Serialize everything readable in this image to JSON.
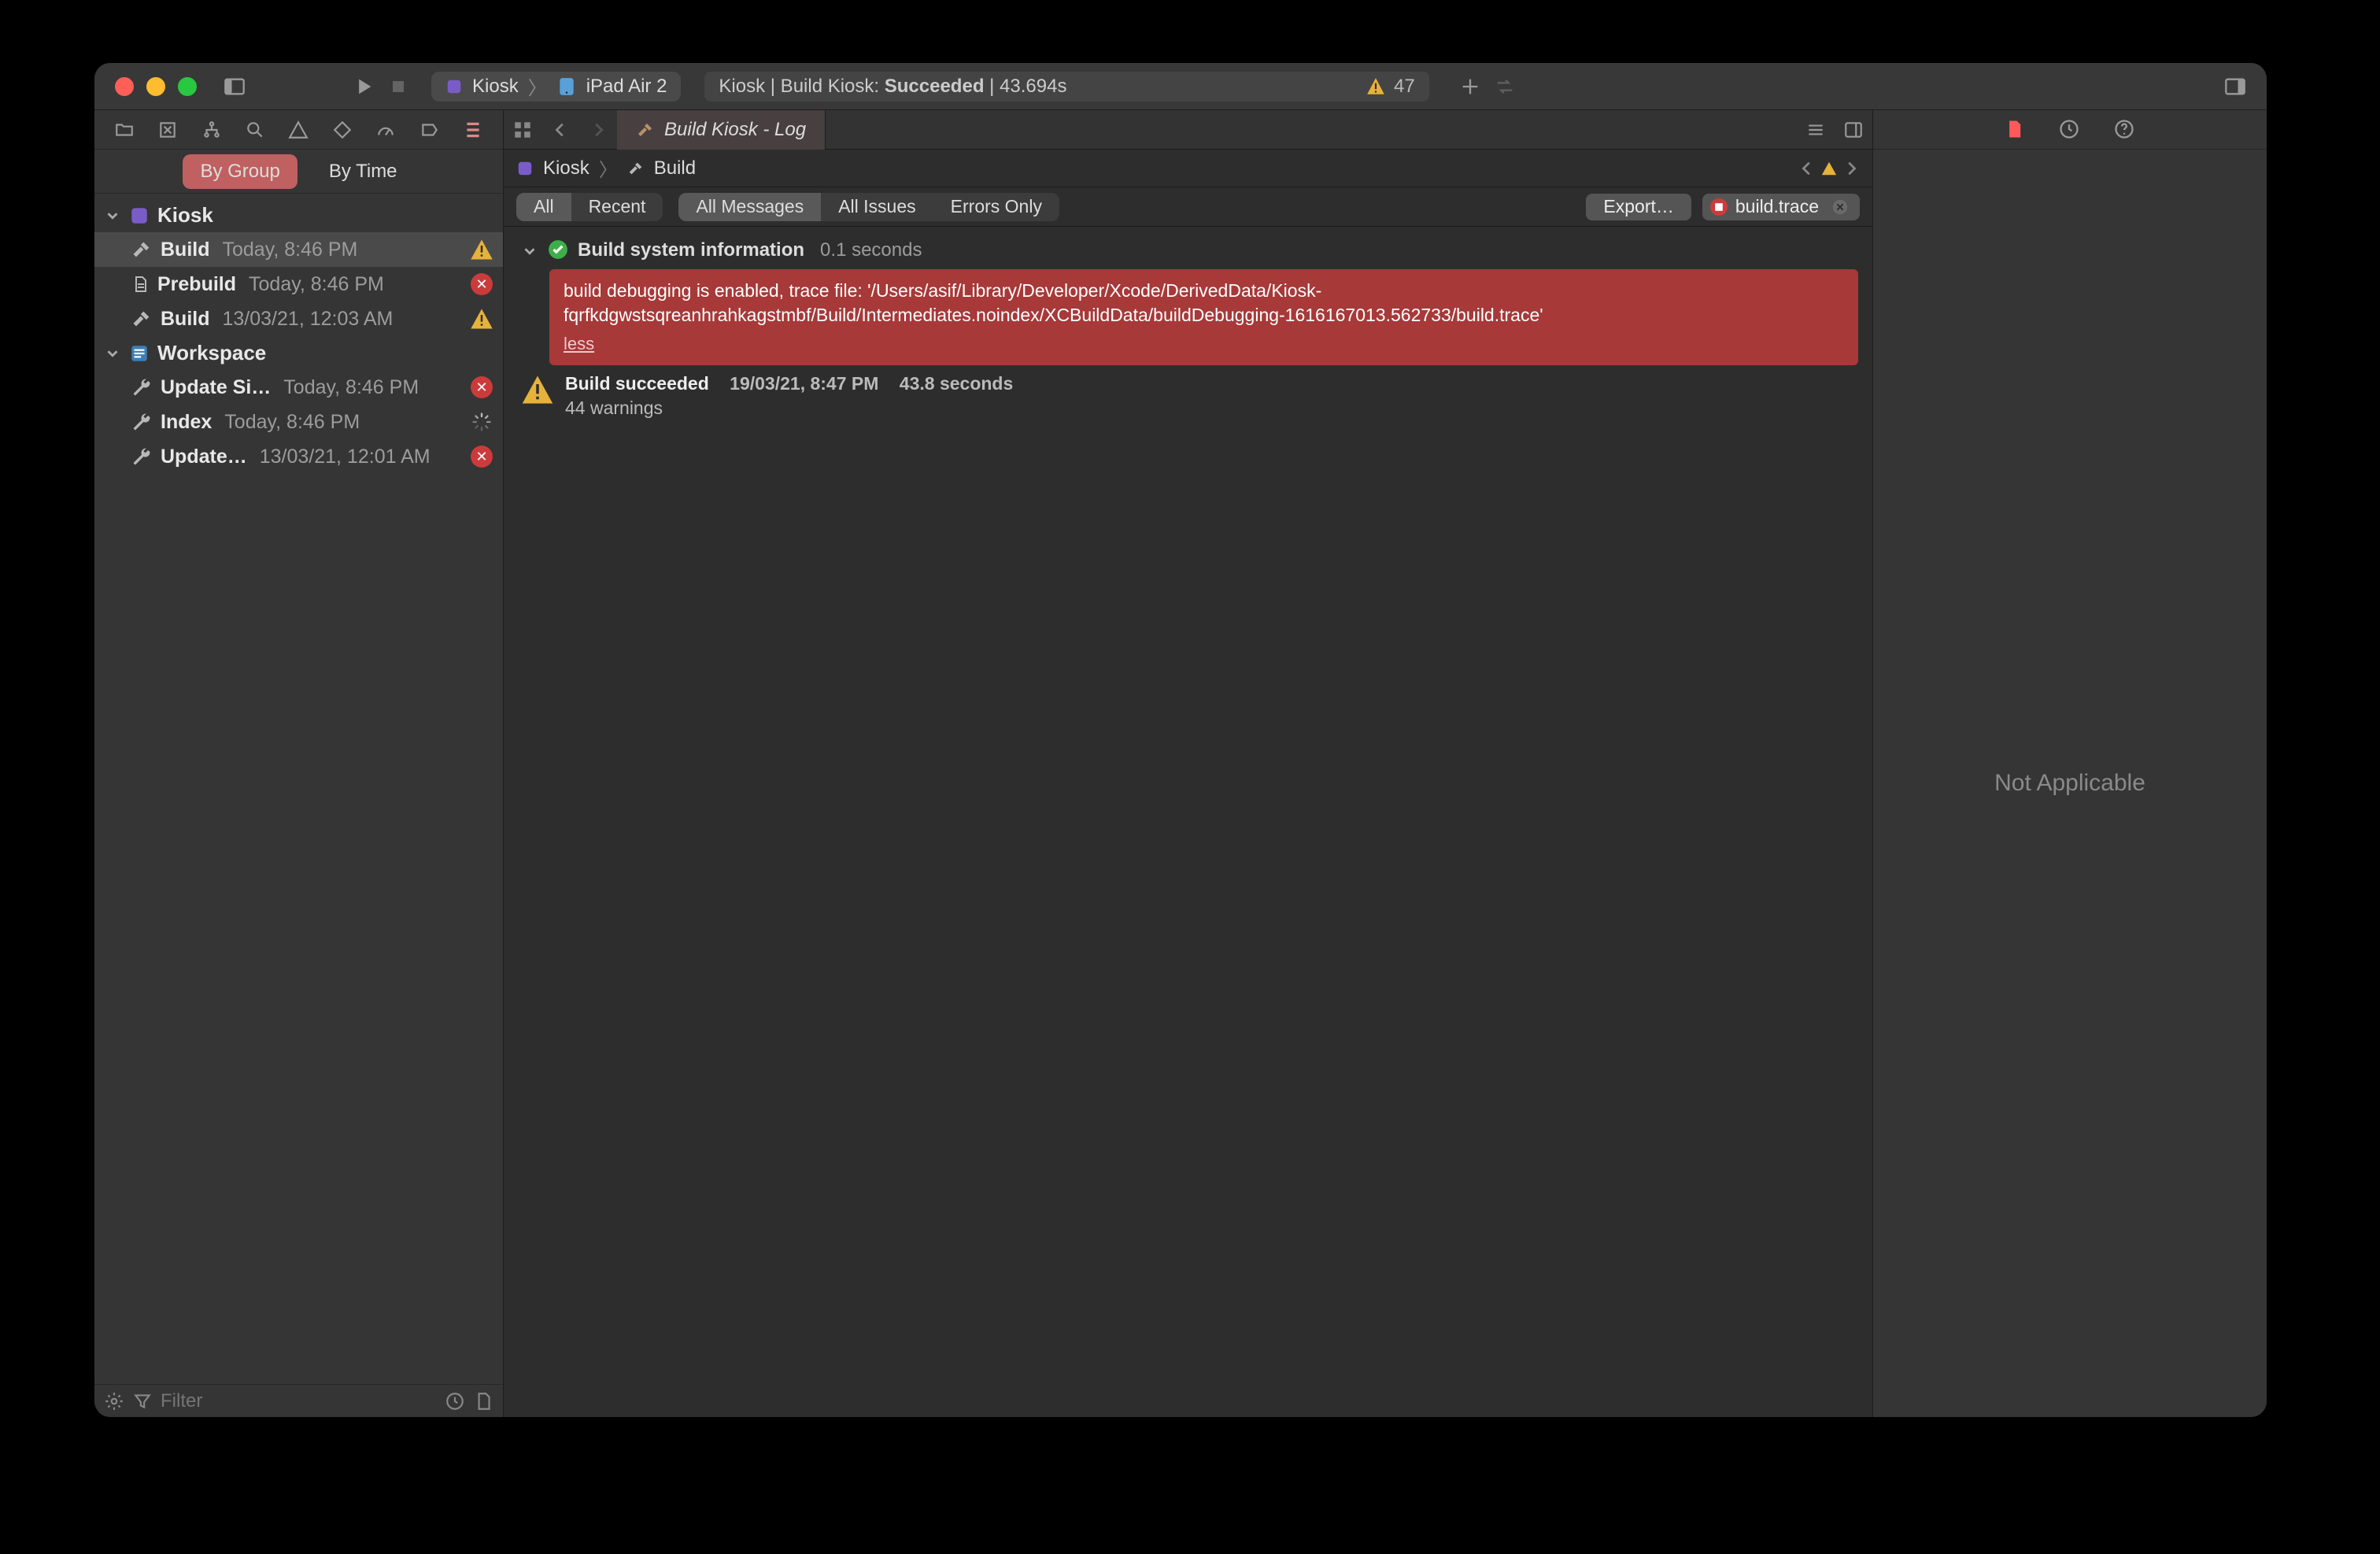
{
  "titlebar": {
    "scheme_project": "Kiosk",
    "scheme_device": "iPad Air 2",
    "status_prefix": "Kiosk | Build Kiosk: ",
    "status_bold": "Succeeded",
    "status_suffix": " | 43.694s",
    "warning_count": "47"
  },
  "nav_segments": {
    "by_group": "By Group",
    "by_time": "By Time"
  },
  "nav_groups": [
    {
      "name": "Kiosk",
      "icon": "app"
    },
    {
      "name": "Workspace",
      "icon": "workspace"
    }
  ],
  "nav_items": {
    "kiosk": [
      {
        "icon": "hammer",
        "label": "Build",
        "time": "Today, 8:46 PM",
        "badge": "warn",
        "selected": true
      },
      {
        "icon": "doc",
        "label": "Prebuild",
        "time": "Today, 8:46 PM",
        "badge": "error"
      },
      {
        "icon": "hammer",
        "label": "Build",
        "time": "13/03/21, 12:03 AM",
        "badge": "warn"
      }
    ],
    "workspace": [
      {
        "icon": "wrench",
        "label": "Update Si…",
        "time": "Today, 8:46 PM",
        "badge": "error"
      },
      {
        "icon": "wrench",
        "label": "Index",
        "time": "Today, 8:46 PM",
        "badge": "spinner"
      },
      {
        "icon": "wrench",
        "label": "Update…",
        "time": "13/03/21, 12:01 AM",
        "badge": "error"
      }
    ]
  },
  "nav_filter_placeholder": "Filter",
  "editor": {
    "tab_title": "Build Kiosk - Log",
    "crumb_project": "Kiosk",
    "crumb_leaf": "Build",
    "filter_all": "All",
    "filter_recent": "Recent",
    "filter_all_messages": "All Messages",
    "filter_all_issues": "All Issues",
    "filter_errors_only": "Errors Only",
    "export_label": "Export…",
    "trace_label": "build.trace",
    "log_header": "Build system information",
    "log_header_time": "0.1 seconds",
    "error_text": "build debugging is enabled, trace file: '/Users/asif/Library/Developer/Xcode/DerivedData/Kiosk-fqrfkdgwstsqreanhrahkagstmbf/Build/Intermediates.noindex/XCBuildData/buildDebugging-1616167013.562733/build.trace'",
    "error_less": "less",
    "summary_status": "Build succeeded",
    "summary_date": "19/03/21, 8:47 PM",
    "summary_duration": "43.8 seconds",
    "summary_warnings": "44 warnings"
  },
  "inspector": {
    "empty_text": "Not Applicable"
  }
}
